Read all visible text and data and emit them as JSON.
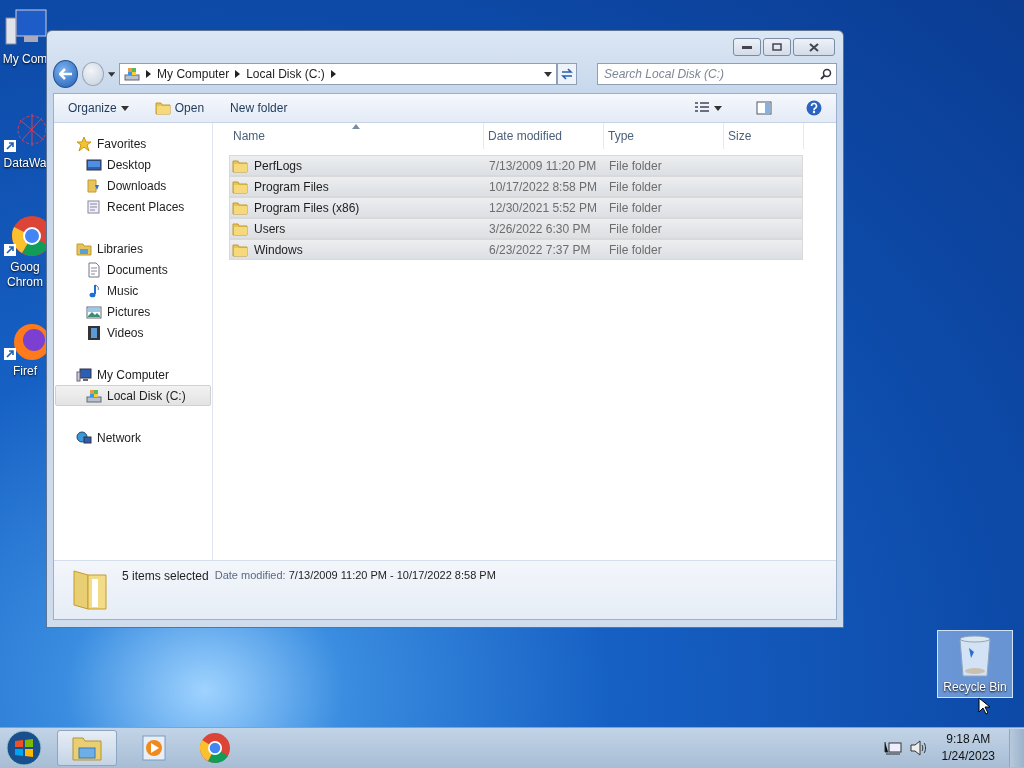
{
  "desktop_icons": [
    {
      "kind": "computer",
      "lines": [
        "My Com"
      ]
    },
    {
      "kind": "datawave",
      "lines": [
        "DataWa"
      ]
    },
    {
      "kind": "chrome",
      "lines": [
        "Goog",
        "Chrom"
      ]
    },
    {
      "kind": "firefox",
      "lines": [
        "Firef"
      ]
    }
  ],
  "recycle_bin": {
    "label": "Recycle Bin",
    "selected": true
  },
  "window": {
    "address_path": [
      "My Computer",
      "Local Disk (C:)"
    ],
    "search": {
      "placeholder": "Search Local Disk (C:)"
    },
    "toolbar": [
      {
        "label": "Organize",
        "kind": "menu"
      },
      {
        "label": "Open",
        "kind": "open"
      },
      {
        "label": "New folder",
        "kind": "plain"
      }
    ],
    "nav_pane": [
      {
        "label": "Favorites",
        "kind": "star",
        "selected": false,
        "children": [
          {
            "label": "Desktop",
            "kind": "desktop",
            "selected": false
          },
          {
            "label": "Downloads",
            "kind": "downloads",
            "selected": false
          },
          {
            "label": "Recent Places",
            "kind": "recent",
            "selected": false
          }
        ]
      },
      {
        "label": "Libraries",
        "kind": "library",
        "selected": false,
        "children": [
          {
            "label": "Documents",
            "kind": "document",
            "selected": false
          },
          {
            "label": "Music",
            "kind": "music",
            "selected": false
          },
          {
            "label": "Pictures",
            "kind": "pictures",
            "selected": false
          },
          {
            "label": "Videos",
            "kind": "video",
            "selected": false
          }
        ]
      },
      {
        "label": "My Computer",
        "kind": "computer",
        "selected": false,
        "children": [
          {
            "label": "Local Disk (C:)",
            "kind": "disk",
            "selected": true
          }
        ]
      },
      {
        "label": "Network",
        "kind": "network",
        "selected": false
      }
    ],
    "columns": [
      {
        "label": "Name",
        "sorted": true
      },
      {
        "label": "Date modified",
        "sorted": false
      },
      {
        "label": "Type",
        "sorted": false
      },
      {
        "label": "Size",
        "sorted": false
      }
    ],
    "rows": [
      {
        "name": "PerfLogs",
        "date": "7/13/2009 11:20 PM",
        "type": "File folder",
        "selected": true
      },
      {
        "name": "Program Files",
        "date": "10/17/2022 8:58 PM",
        "type": "File folder",
        "selected": true
      },
      {
        "name": "Program Files (x86)",
        "date": "12/30/2021 5:52 PM",
        "type": "File folder",
        "selected": true
      },
      {
        "name": "Users",
        "date": "3/26/2022 6:30 PM",
        "type": "File folder",
        "selected": true
      },
      {
        "name": "Windows",
        "date": "6/23/2022 7:37 PM",
        "type": "File folder",
        "selected": true
      }
    ],
    "details": {
      "count": "5 items selected",
      "label": "Date modified:",
      "value": "7/13/2009 11:20 PM - 10/17/2022 8:58 PM"
    }
  },
  "taskbar": {
    "apps": [
      {
        "kind": "explorer",
        "active": true
      },
      {
        "kind": "media",
        "active": false
      },
      {
        "kind": "chrome",
        "active": false
      }
    ],
    "clock": {
      "time": "9:18 AM",
      "date": "1/24/2023"
    }
  }
}
